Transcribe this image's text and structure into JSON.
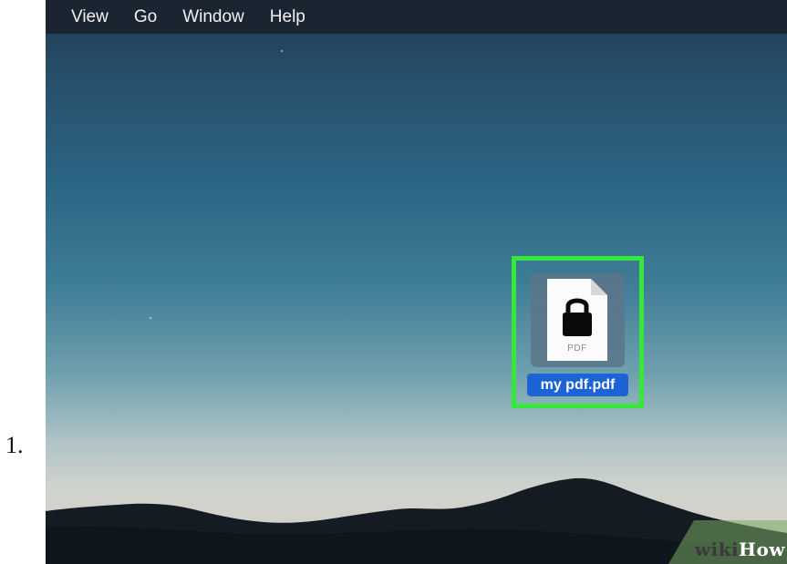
{
  "step": {
    "number": "1."
  },
  "menubar": {
    "items": [
      "View",
      "Go",
      "Window",
      "Help"
    ]
  },
  "desktop": {
    "file": {
      "name": "my pdf.pdf",
      "type_label": "PDF",
      "icon": "locked-pdf-file-icon",
      "selected": true,
      "highlight_color": "#35e83a",
      "selection_color": "#1c63d6"
    }
  },
  "watermark": {
    "part1": "wiki",
    "part2": "How"
  }
}
